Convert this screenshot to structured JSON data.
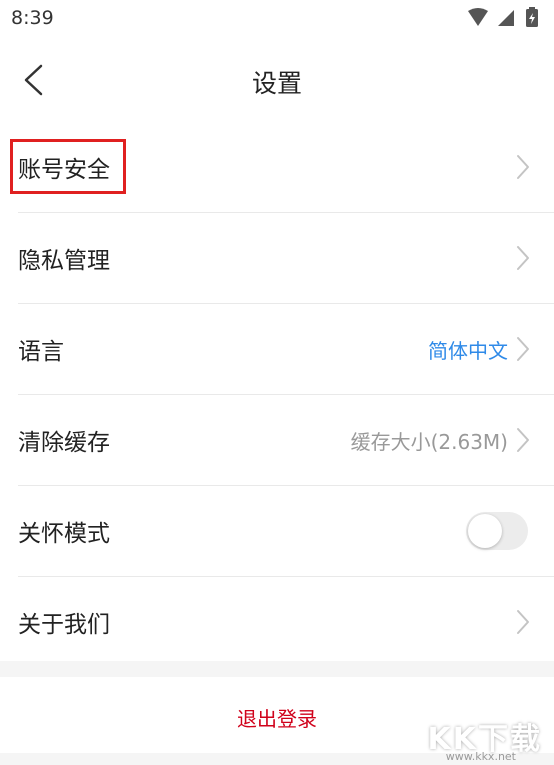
{
  "status_bar": {
    "time": "8:39"
  },
  "header": {
    "title": "设置"
  },
  "settings": {
    "account_security": {
      "label": "账号安全"
    },
    "privacy": {
      "label": "隐私管理"
    },
    "language": {
      "label": "语言",
      "value": "简体中文",
      "value_color": "#2f8ae8"
    },
    "clear_cache": {
      "label": "清除缓存",
      "value": "缓存大小(2.63M)",
      "value_color": "#999999"
    },
    "care_mode": {
      "label": "关怀模式",
      "enabled": false
    },
    "about": {
      "label": "关于我们"
    }
  },
  "logout": {
    "label": "退出登录",
    "color": "#d0021b"
  },
  "watermark": {
    "text": "KK下载",
    "url": "www.kkx.net"
  },
  "highlight_color": "#e02020"
}
